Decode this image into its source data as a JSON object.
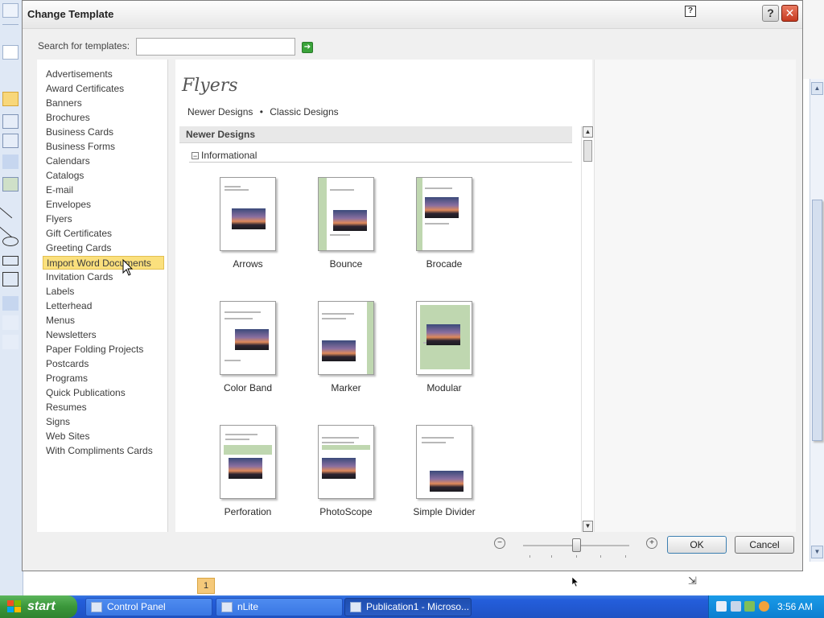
{
  "dialog": {
    "title": "Change Template",
    "help_label": "?",
    "close_label": "✕",
    "search": {
      "label": "Search for templates:",
      "value": "",
      "go_icon": "arrow-right-icon"
    },
    "categories": [
      "Advertisements",
      "Award Certificates",
      "Banners",
      "Brochures",
      "Business Cards",
      "Business Forms",
      "Calendars",
      "Catalogs",
      "E-mail",
      "Envelopes",
      "Flyers",
      "Gift Certificates",
      "Greeting Cards",
      "Import Word Documents",
      "Invitation Cards",
      "Labels",
      "Letterhead",
      "Menus",
      "Newsletters",
      "Paper Folding Projects",
      "Postcards",
      "Programs",
      "Quick Publications",
      "Resumes",
      "Signs",
      "Web Sites",
      "With Compliments Cards"
    ],
    "selected_category_index": 13,
    "content": {
      "heading": "Flyers",
      "links": [
        "Newer Designs",
        "Classic Designs"
      ],
      "link_separator": "•",
      "section": "Newer Designs",
      "subsection": "Informational",
      "collapse_glyph": "−",
      "templates": [
        "Arrows",
        "Bounce",
        "Brocade",
        "Color Band",
        "Marker",
        "Modular",
        "Perforation",
        "PhotoScope",
        "Simple Divider"
      ]
    },
    "ok_label": "OK",
    "cancel_label": "Cancel"
  },
  "notification_badge": "1",
  "taskbar": {
    "start_label": "start",
    "tasks": [
      {
        "label": "Control Panel",
        "active": false
      },
      {
        "label": "nLite",
        "active": false
      },
      {
        "label": "Publication1 - Microso...",
        "active": true
      }
    ],
    "clock": "3:56 AM"
  },
  "colors": {
    "selection": "#fbe07d",
    "taskbar": "#245edb",
    "start": "#3a963a",
    "tray": "#0c7fd0"
  }
}
